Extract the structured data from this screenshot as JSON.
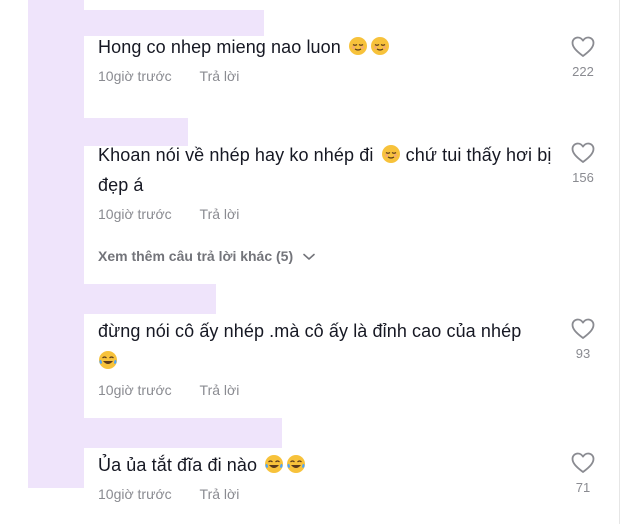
{
  "comments": [
    {
      "text": "Hong co nhep mieng nao luon",
      "emojis": [
        "relieved-face-emoji",
        "relieved-face-emoji"
      ],
      "time": "10giờ trước",
      "reply": "Trả lời",
      "likes": "222"
    },
    {
      "text": "Khoan nói về nhép hay ko nhép đi",
      "text_after": "chứ tui thấy hơi bị đẹp á",
      "emojis": [
        "relieved-face-emoji"
      ],
      "time": "10giờ trước",
      "reply": "Trả lời",
      "likes": "156"
    },
    {
      "text": "đừng nói cô ấy nhép .mà cô ấy là đỉnh cao của nhép",
      "emojis": [
        "tears-of-joy-emoji"
      ],
      "time": "10giờ trước",
      "reply": "Trả lời",
      "likes": "93"
    },
    {
      "text": "Ủa ủa tắt đĩa đi nào",
      "emojis": [
        "tears-of-joy-emoji",
        "tears-of-joy-emoji"
      ],
      "time": "10giờ trước",
      "reply": "Trả lời",
      "likes": "71"
    }
  ],
  "more_replies": "Xem thêm câu trả lời khác (5)",
  "colors": {
    "mask": "#efe4fb",
    "text": "#161823",
    "meta": "#8a8b91",
    "emoji": "#f7c23b"
  }
}
